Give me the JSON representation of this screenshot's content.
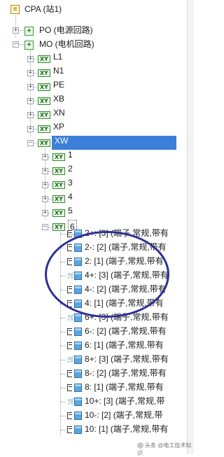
{
  "root": {
    "label": "CPA (站1)"
  },
  "groups": [
    {
      "label": "PO (电源回路)",
      "expander": "+"
    },
    {
      "label": "MO (电机回路)",
      "expander": "−"
    }
  ],
  "cables": [
    {
      "badge": "XY",
      "label": "L1"
    },
    {
      "badge": "XY",
      "label": "N1"
    },
    {
      "badge": "XY",
      "label": "PE"
    },
    {
      "badge": "XY",
      "label": "XB"
    },
    {
      "badge": "XY",
      "label": "XN"
    },
    {
      "badge": "XY",
      "label": "XP"
    },
    {
      "badge": "XY",
      "label": "XW",
      "selected": true
    }
  ],
  "sub_items": [
    {
      "badge": "XY",
      "label": "1"
    },
    {
      "badge": "XY",
      "label": "2"
    },
    {
      "badge": "XY",
      "label": "3"
    },
    {
      "badge": "XY",
      "label": "4"
    },
    {
      "badge": "XY",
      "label": "5"
    },
    {
      "badge": "XY",
      "label": "6"
    }
  ],
  "terminals": [
    {
      "label": "2+: [3] (端子,常规,带有",
      "icon": "terminal"
    },
    {
      "label": "2-: [2] (端子,常规,带有",
      "icon": "terminal"
    },
    {
      "label": "2: [1] (端子,常规,带有",
      "icon": "terminal"
    },
    {
      "label": "4+: [3] (端子,常规,带有",
      "icon": "cart"
    },
    {
      "label": "4-: [2] (端子,常规,带有",
      "icon": "terminal"
    },
    {
      "label": "4: [1] (端子,常规,带有",
      "icon": "terminal"
    },
    {
      "label": "6+: [3] (端子,常规,带有",
      "icon": "cart"
    },
    {
      "label": "6-: [2] (端子,常规,带有",
      "icon": "terminal"
    },
    {
      "label": "6: [1] (端子,常规,带有",
      "icon": "terminal"
    },
    {
      "label": "8+: [3] (端子,常规,带有",
      "icon": "cart"
    },
    {
      "label": "8-: [2] (端子,常规,带有",
      "icon": "terminal"
    },
    {
      "label": "8: [1] (端子,常规,带有",
      "icon": "terminal"
    },
    {
      "label": "10+: [3] (端子,常规,带",
      "icon": "cart"
    },
    {
      "label": "10-: [2] (端子,常规,带",
      "icon": "terminal"
    },
    {
      "label": "10: [1] (端子,常规,带有",
      "icon": "terminal"
    }
  ],
  "watermark": "头条 @电工技术知识"
}
